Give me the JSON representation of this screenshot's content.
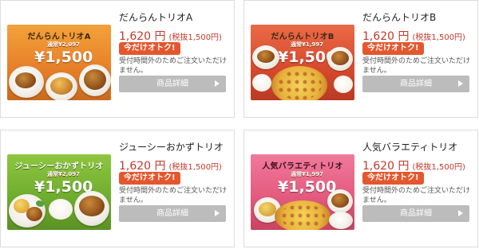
{
  "products": [
    {
      "title": "だんらんトリオA",
      "price": "1,620 円",
      "price_tax": "(税抜1,500円)",
      "badge": "今だけオトク!",
      "notice": "受付時間外のためご注文いただけません。",
      "button_label": "商品詳細",
      "thumb": {
        "banner": "だんらんトリオA",
        "sub": "通常¥2,097",
        "price": "¥1,500"
      }
    },
    {
      "title": "だんらんトリオB",
      "price": "1,620 円",
      "price_tax": "(税抜1,500円)",
      "badge": "今だけオトク!",
      "notice": "受付時間外のためご注文いただけません。",
      "button_label": "商品詳細",
      "thumb": {
        "banner": "だんらんトリオB",
        "sub": "通常¥1,997",
        "price": "¥1,500"
      }
    },
    {
      "title": "ジューシーおかずトリオ",
      "price": "1,620 円",
      "price_tax": "(税抜1,500円)",
      "badge": "今だけオトク!",
      "notice": "受付時間外のためご注文いただけません。",
      "button_label": "商品詳細",
      "thumb": {
        "banner": "ジューシーおかずトリオ",
        "sub": "通常¥2,097",
        "price": "¥1,500"
      }
    },
    {
      "title": "人気バラエティトリオ",
      "price": "1,620 円",
      "price_tax": "(税抜1,500円)",
      "badge": "今だけオトク!",
      "notice": "受付時間外のためご注文いただけません。",
      "button_label": "商品詳細",
      "thumb": {
        "banner": "人気バラエティトリオ",
        "sub": "通常¥1,997",
        "price": "¥1,500"
      }
    }
  ],
  "icons": {
    "button_arrow": "chevron-right-icon"
  },
  "colors": {
    "price": "#c0392b",
    "badge": "#e4572e",
    "button": "#bcbcbc"
  }
}
